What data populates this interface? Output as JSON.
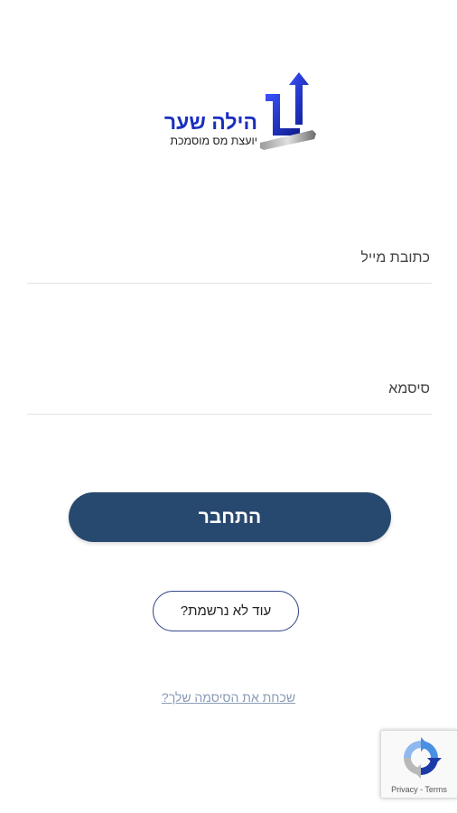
{
  "logo": {
    "title": "הילה שער",
    "subtitle": "יועצת מס מוסמכת",
    "brand_color": "#1a2fbf"
  },
  "form": {
    "email": {
      "placeholder": "כתובת מייל",
      "value": ""
    },
    "password": {
      "placeholder": "סיסמא",
      "value": ""
    },
    "login_label": "התחבר",
    "register_label": "עוד לא נרשמת?",
    "forgot_label": "שכחת את הסיסמה שלך?"
  },
  "recaptcha": {
    "label": "Privacy - Terms",
    "icon": "recaptcha-icon"
  },
  "colors": {
    "primary_button": "#28496f",
    "link": "#8a9bb5"
  }
}
